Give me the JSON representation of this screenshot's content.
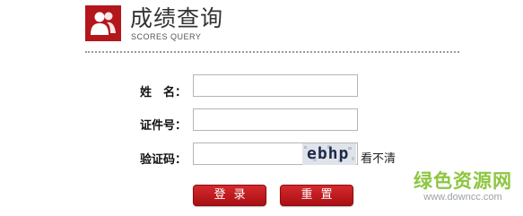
{
  "header": {
    "title": "成绩查询",
    "subtitle": "SCORES QUERY",
    "icon": "users-icon",
    "brand_color": "#b3171c"
  },
  "form": {
    "name_label": "姓　名：",
    "id_label": "证件号：",
    "captcha_label": "验证码：",
    "name_value": "",
    "id_value": "",
    "captcha_value": "",
    "captcha_text": "ebhp",
    "refresh_text": "看不清"
  },
  "buttons": {
    "login": "登录",
    "reset": "重置"
  },
  "watermark": {
    "text": "绿色资源网",
    "url": "www.downcc.com"
  }
}
